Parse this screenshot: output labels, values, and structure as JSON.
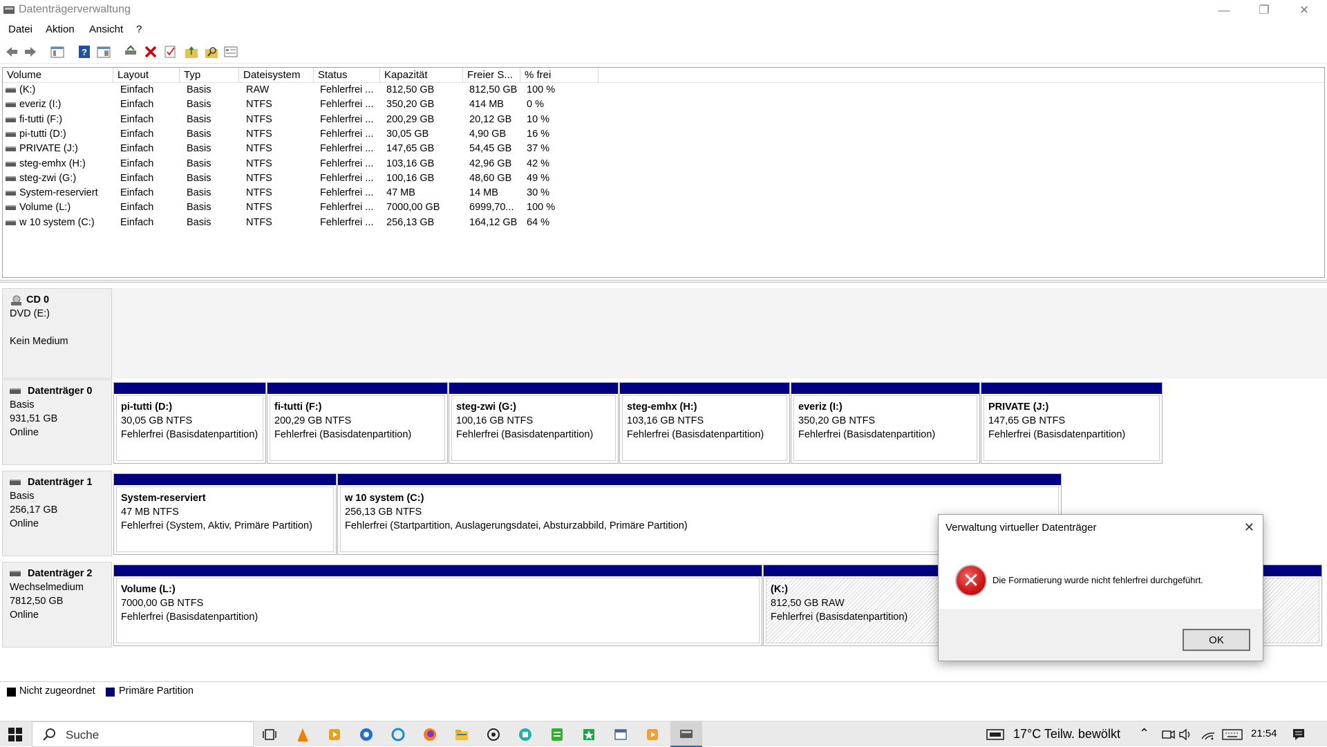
{
  "window": {
    "title": "Datenträgerverwaltung"
  },
  "menu": [
    "Datei",
    "Aktion",
    "Ansicht",
    "?"
  ],
  "columns": [
    "Volume",
    "Layout",
    "Typ",
    "Dateisystem",
    "Status",
    "Kapazität",
    "Freier S...",
    "% frei"
  ],
  "volumes": [
    [
      "(K:)",
      "Einfach",
      "Basis",
      "RAW",
      "Fehlerfrei ...",
      "812,50 GB",
      "812,50 GB",
      "100 %"
    ],
    [
      "everiz (I:)",
      "Einfach",
      "Basis",
      "NTFS",
      "Fehlerfrei ...",
      "350,20 GB",
      "414 MB",
      "0 %"
    ],
    [
      "fi-tutti (F:)",
      "Einfach",
      "Basis",
      "NTFS",
      "Fehlerfrei ...",
      "200,29 GB",
      "20,12 GB",
      "10 %"
    ],
    [
      "pi-tutti (D:)",
      "Einfach",
      "Basis",
      "NTFS",
      "Fehlerfrei ...",
      "30,05 GB",
      "4,90 GB",
      "16 %"
    ],
    [
      "PRIVATE (J:)",
      "Einfach",
      "Basis",
      "NTFS",
      "Fehlerfrei ...",
      "147,65 GB",
      "54,45 GB",
      "37 %"
    ],
    [
      "steg-emhx (H:)",
      "Einfach",
      "Basis",
      "NTFS",
      "Fehlerfrei ...",
      "103,16 GB",
      "42,96 GB",
      "42 %"
    ],
    [
      "steg-zwi (G:)",
      "Einfach",
      "Basis",
      "NTFS",
      "Fehlerfrei ...",
      "100,16 GB",
      "48,60 GB",
      "49 %"
    ],
    [
      "System-reserviert",
      "Einfach",
      "Basis",
      "NTFS",
      "Fehlerfrei ...",
      "47 MB",
      "14 MB",
      "30 %"
    ],
    [
      "Volume (L:)",
      "Einfach",
      "Basis",
      "NTFS",
      "Fehlerfrei ...",
      "7000,00 GB",
      "6999,70...",
      "100 %"
    ],
    [
      "w 10 system (C:)",
      "Einfach",
      "Basis",
      "NTFS",
      "Fehlerfrei ...",
      "256,13 GB",
      "164,12 GB",
      "64 %"
    ]
  ],
  "disks": {
    "cd0": {
      "name": "CD 0",
      "type": "DVD (E:)",
      "status": "Kein Medium"
    },
    "disk0": {
      "name": "Datenträger 0",
      "type": "Basis",
      "size": "931,51 GB",
      "status": "Online",
      "partitions": [
        {
          "name": "pi-tutti  (D:)",
          "size": "30,05 GB NTFS",
          "status": "Fehlerfrei (Basisdatenpartition)"
        },
        {
          "name": "fi-tutti  (F:)",
          "size": "200,29 GB NTFS",
          "status": "Fehlerfrei (Basisdatenpartition)"
        },
        {
          "name": "steg-zwi  (G:)",
          "size": "100,16 GB NTFS",
          "status": "Fehlerfrei (Basisdatenpartition)"
        },
        {
          "name": "steg-emhx  (H:)",
          "size": "103,16 GB NTFS",
          "status": "Fehlerfrei (Basisdatenpartition)"
        },
        {
          "name": "everiz  (I:)",
          "size": "350,20 GB NTFS",
          "status": "Fehlerfrei (Basisdatenpartition)"
        },
        {
          "name": "PRIVATE  (J:)",
          "size": "147,65 GB NTFS",
          "status": "Fehlerfrei (Basisdatenpartition)"
        }
      ]
    },
    "disk1": {
      "name": "Datenträger 1",
      "type": "Basis",
      "size": "256,17 GB",
      "status": "Online",
      "partitions": [
        {
          "name": "System-reserviert",
          "size": "47 MB NTFS",
          "status": "Fehlerfrei (System, Aktiv, Primäre Partition)"
        },
        {
          "name": "w 10 system  (C:)",
          "size": "256,13 GB NTFS",
          "status": "Fehlerfrei (Startpartition, Auslagerungsdatei, Absturzabbild, Primäre Partition)"
        }
      ]
    },
    "disk2": {
      "name": "Datenträger 2",
      "type": "Wechselmedium",
      "size": "7812,50 GB",
      "status": "Online",
      "partitions": [
        {
          "name": "Volume  (L:)",
          "size": "7000,00 GB NTFS",
          "status": "Fehlerfrei (Basisdatenpartition)"
        },
        {
          "name": "(K:)",
          "size": "812,50 GB RAW",
          "status": "Fehlerfrei (Basisdatenpartition)"
        }
      ]
    }
  },
  "legend": {
    "unallocated": "Nicht zugeordnet",
    "primary": "Primäre Partition"
  },
  "dialog": {
    "title": "Verwaltung virtueller Datenträger",
    "message": "Die Formatierung wurde nicht fehlerfrei durchgeführt.",
    "ok": "OK"
  },
  "taskbar": {
    "search": "Suche",
    "weather": "17°C  Teilw. bewölkt",
    "time": "21:54"
  },
  "colors": {
    "primary_partition": "#000080",
    "unallocated": "#000000",
    "error": "#d01c1c"
  }
}
